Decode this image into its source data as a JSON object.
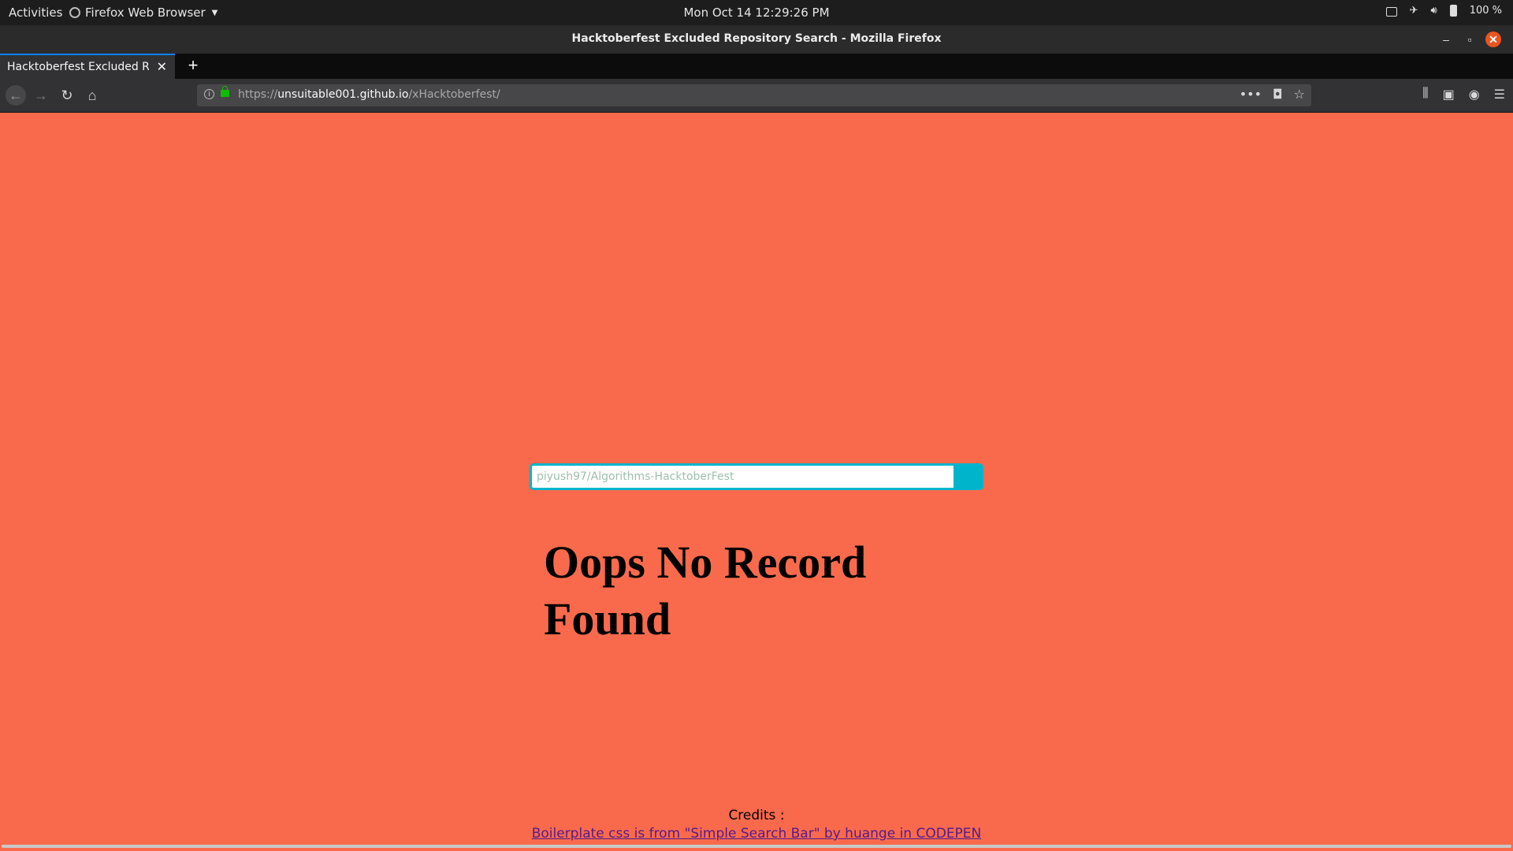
{
  "system": {
    "activities": "Activities",
    "app_menu": "Firefox Web Browser",
    "clock": "Mon Oct 14  12:29:26 PM",
    "battery": "100 %"
  },
  "window": {
    "title": "Hacktoberfest Excluded Repository Search - Mozilla Firefox"
  },
  "tabs": [
    {
      "label": "Hacktoberfest Excluded Repos"
    }
  ],
  "navbar": {
    "url_scheme": "https://",
    "url_host": "unsuitable001.github.io",
    "url_path": "/xHacktoberfest/"
  },
  "page": {
    "search_placeholder": "piyush97/Algorithms-HacktoberFest",
    "message": "Oops No Record Found",
    "credits_label": "Credits :",
    "credits_link": "Boilerplate css is from \"Simple Search Bar\" by huange in CODEPEN"
  },
  "colors": {
    "page_background": "#f96a4c",
    "search_accent": "#00b4cc",
    "link": "#551a8b"
  }
}
